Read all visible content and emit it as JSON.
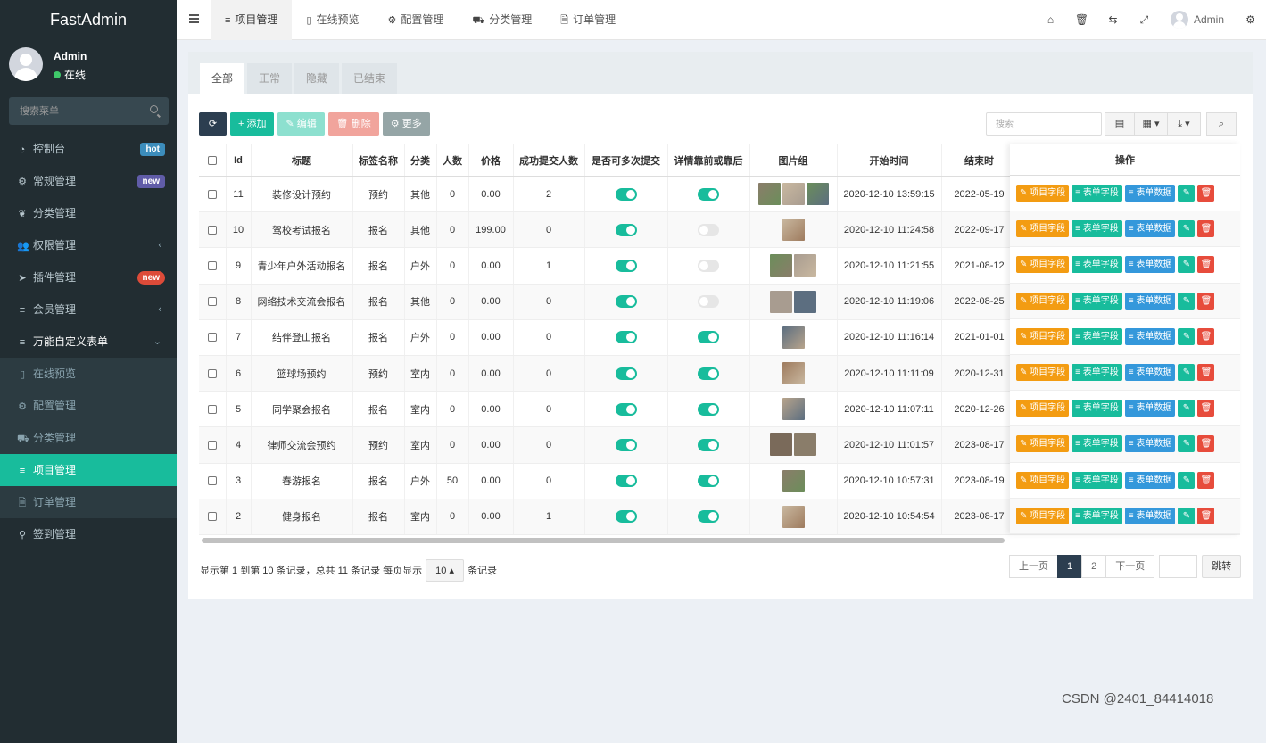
{
  "sidebar": {
    "logo": "FastAdmin",
    "user": {
      "name": "Admin",
      "status": "在线"
    },
    "search_placeholder": "搜索菜单",
    "menu": [
      {
        "label": "控制台",
        "badge": "hot",
        "icon": "dashboard-icon"
      },
      {
        "label": "常规管理",
        "badge": "new",
        "icon": "cogs-icon"
      },
      {
        "label": "分类管理",
        "icon": "leaf-icon"
      },
      {
        "label": "权限管理",
        "icon": "group-icon",
        "chevron": "‹"
      },
      {
        "label": "插件管理",
        "badge": "new",
        "icon": "rocket-icon"
      },
      {
        "label": "会员管理",
        "icon": "list-icon",
        "chevron": "‹"
      },
      {
        "label": "万能自定义表单",
        "icon": "list-icon",
        "chevron": "⌄"
      }
    ],
    "submenu": [
      {
        "label": "在线预览",
        "icon": "mobile-icon"
      },
      {
        "label": "配置管理",
        "icon": "gear-icon"
      },
      {
        "label": "分类管理",
        "icon": "cart-icon"
      },
      {
        "label": "项目管理",
        "icon": "list-icon",
        "active": true
      },
      {
        "label": "订单管理",
        "icon": "file-icon"
      }
    ],
    "after": [
      {
        "label": "签到管理",
        "icon": "map-marker-icon"
      }
    ]
  },
  "topbar": {
    "tabs": [
      {
        "label": "项目管理",
        "icon": "≡",
        "active": true
      },
      {
        "label": "在线预览",
        "icon": "▯"
      },
      {
        "label": "配置管理",
        "icon": "⚙"
      },
      {
        "label": "分类管理",
        "icon": "⛟"
      },
      {
        "label": "订单管理",
        "icon": "🗎"
      }
    ],
    "user": "Admin"
  },
  "panel": {
    "tabs": [
      "全部",
      "正常",
      "隐藏",
      "已结束"
    ],
    "toolbar": {
      "add": "添加",
      "edit": "编辑",
      "delete": "删除",
      "more": "更多"
    },
    "search_placeholder": "搜索"
  },
  "table": {
    "headers": [
      "Id",
      "标题",
      "标签名称",
      "分类",
      "人数",
      "价格",
      "成功提交人数",
      "是否可多次提交",
      "详情靠前或靠后",
      "图片组",
      "开始时间",
      "结束时"
    ],
    "op_header": "操作",
    "op_buttons": {
      "fields": "项目字段",
      "form_fields": "表单字段",
      "form_data": "表单数据"
    },
    "rows": [
      {
        "id": "11",
        "title": "装修设计预约",
        "tag": "预约",
        "cat": "其他",
        "num": "0",
        "price": "0.00",
        "success": "2",
        "multi": true,
        "detail": true,
        "imgs": 3,
        "start": "2020-12-10 13:59:15",
        "end": "2022-05-19"
      },
      {
        "id": "10",
        "title": "驾校考试报名",
        "tag": "报名",
        "cat": "其他",
        "num": "0",
        "price": "199.00",
        "success": "0",
        "multi": true,
        "detail": false,
        "imgs": 1,
        "start": "2020-12-10 11:24:58",
        "end": "2022-09-17"
      },
      {
        "id": "9",
        "title": "青少年户外活动报名",
        "tag": "报名",
        "cat": "户外",
        "num": "0",
        "price": "0.00",
        "success": "1",
        "multi": true,
        "detail": false,
        "imgs": 2,
        "start": "2020-12-10 11:21:55",
        "end": "2021-08-12"
      },
      {
        "id": "8",
        "title": "网络技术交流会报名",
        "tag": "报名",
        "cat": "其他",
        "num": "0",
        "price": "0.00",
        "success": "0",
        "multi": true,
        "detail": false,
        "imgs": 2,
        "start": "2020-12-10 11:19:06",
        "end": "2022-08-25"
      },
      {
        "id": "7",
        "title": "结伴登山报名",
        "tag": "报名",
        "cat": "户外",
        "num": "0",
        "price": "0.00",
        "success": "0",
        "multi": true,
        "detail": true,
        "imgs": 1,
        "start": "2020-12-10 11:16:14",
        "end": "2021-01-01"
      },
      {
        "id": "6",
        "title": "篮球场预约",
        "tag": "预约",
        "cat": "室内",
        "num": "0",
        "price": "0.00",
        "success": "0",
        "multi": true,
        "detail": true,
        "imgs": 1,
        "start": "2020-12-10 11:11:09",
        "end": "2020-12-31"
      },
      {
        "id": "5",
        "title": "同学聚会报名",
        "tag": "报名",
        "cat": "室内",
        "num": "0",
        "price": "0.00",
        "success": "0",
        "multi": true,
        "detail": true,
        "imgs": 1,
        "start": "2020-12-10 11:07:11",
        "end": "2020-12-26"
      },
      {
        "id": "4",
        "title": "律师交流会预约",
        "tag": "预约",
        "cat": "室内",
        "num": "0",
        "price": "0.00",
        "success": "0",
        "multi": true,
        "detail": true,
        "imgs": 2,
        "start": "2020-12-10 11:01:57",
        "end": "2023-08-17"
      },
      {
        "id": "3",
        "title": "春游报名",
        "tag": "报名",
        "cat": "户外",
        "num": "50",
        "price": "0.00",
        "success": "0",
        "multi": true,
        "detail": true,
        "imgs": 1,
        "start": "2020-12-10 10:57:31",
        "end": "2023-08-19"
      },
      {
        "id": "2",
        "title": "健身报名",
        "tag": "报名",
        "cat": "室内",
        "num": "0",
        "price": "0.00",
        "success": "1",
        "multi": true,
        "detail": true,
        "imgs": 1,
        "start": "2020-12-10 10:54:54",
        "end": "2023-08-17"
      }
    ]
  },
  "footer": {
    "info": "显示第 1 到第 10 条记录，总共 11 条记录 每页显示",
    "page_size": "10",
    "info_suffix": "条记录",
    "prev": "上一页",
    "pages": [
      "1",
      "2"
    ],
    "next": "下一页",
    "go": "跳转"
  },
  "watermark": "CSDN @2401_84414018"
}
